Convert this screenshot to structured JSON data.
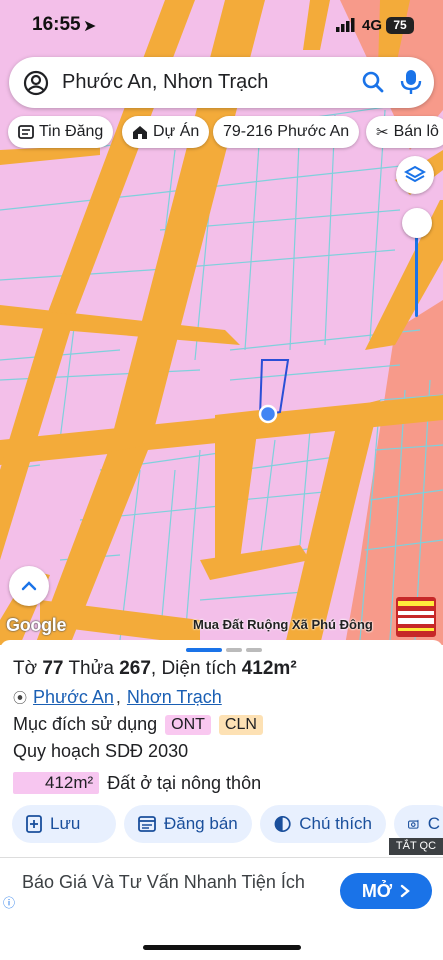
{
  "status_bar": {
    "time": "16:55",
    "network": "4G",
    "battery": "75"
  },
  "search": {
    "query": "Phước An, Nhơn Trạch"
  },
  "chips": [
    {
      "label": "Tin Đăng",
      "icon": "listing-icon"
    },
    {
      "label": "Dự Án",
      "icon": "house-icon"
    },
    {
      "label": "79-216 Phước An",
      "icon": ""
    },
    {
      "label": "Bán lô",
      "icon": "tools-icon"
    }
  ],
  "map": {
    "attribution": "Google",
    "ad_label": "Mua Đất Ruộng Xã Phú Đông",
    "colors": {
      "residential": "#f3bfe9",
      "road": "#f3ab3a",
      "zone_salmon": "#f79a8a",
      "parcel_lines": "#7fd0dc"
    }
  },
  "parcel": {
    "to_label": "Tờ",
    "to_value": "77",
    "thua_label": "Thửa",
    "thua_value": "267",
    "area_label": "Diện tích",
    "area_value": "412m²",
    "ward": "Phước An",
    "district": "Nhơn Trạch",
    "purpose_label": "Mục đích sử dụng",
    "purpose_tags": [
      "ONT",
      "CLN"
    ],
    "plan_label": "Quy hoạch SDĐ 2030",
    "plan_area": "412m²",
    "plan_desc": "Đất ở tại nông thôn"
  },
  "actions": [
    {
      "label": "Lưu",
      "icon": "save-icon"
    },
    {
      "label": "Đăng bán",
      "icon": "post-icon"
    },
    {
      "label": "Chú thích",
      "icon": "legend-icon"
    },
    {
      "label": "C",
      "icon": "camera-icon"
    }
  ],
  "ad": {
    "close_label": "TẮT QC",
    "text": "Báo Giá Và Tư Vấn Nhanh Tiện Ích",
    "button_label": "MỞ"
  }
}
